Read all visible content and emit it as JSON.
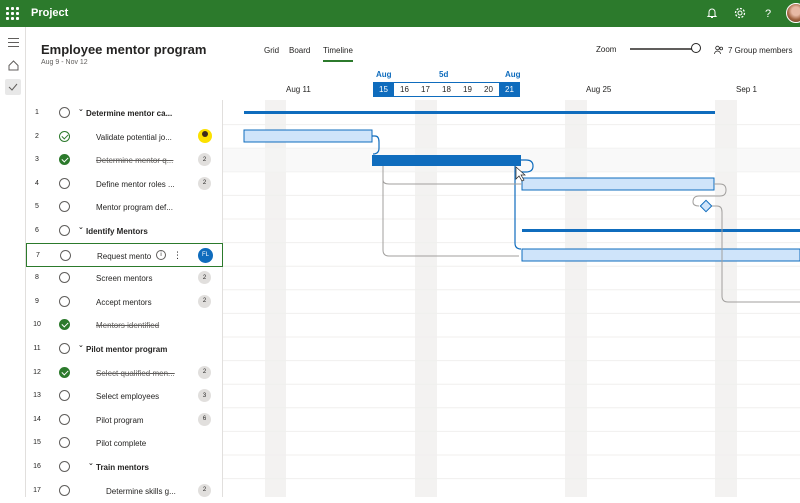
{
  "app": {
    "name": "Project"
  },
  "project": {
    "title": "Employee mentor program",
    "dates": "Aug 9 - Nov 12"
  },
  "views": [
    "Grid",
    "Board",
    "Timeline"
  ],
  "zoom": {
    "label": "Zoom",
    "level": 0.9
  },
  "group_members": "7 Group members",
  "timeline_header": {
    "months": [
      "Aug 11",
      "Aug 25",
      "Sep 1"
    ],
    "range_start_label": "Aug",
    "range_mid_label": "5d",
    "range_end_label": "Aug",
    "days": [
      "15",
      "16",
      "17",
      "18",
      "19",
      "20",
      "21"
    ]
  },
  "tasks": [
    {
      "num": "1",
      "name": "Determine mentor ca...",
      "summary": true,
      "status": "open"
    },
    {
      "num": "2",
      "name": "Validate potential jo...",
      "status": "half",
      "assignee": "person"
    },
    {
      "num": "3",
      "name": "Determine mentor q...",
      "status": "done",
      "badge": "2"
    },
    {
      "num": "4",
      "name": "Define mentor roles ...",
      "status": "open",
      "badge": "2"
    },
    {
      "num": "5",
      "name": "Mentor program def...",
      "status": "open"
    },
    {
      "num": "6",
      "name": "Identify Mentors",
      "summary": true,
      "status": "open"
    },
    {
      "num": "7",
      "name": "Request mento",
      "status": "open",
      "assignee_initials": "FL",
      "selected": true
    },
    {
      "num": "8",
      "name": "Screen mentors",
      "status": "open",
      "badge": "2"
    },
    {
      "num": "9",
      "name": "Accept mentors",
      "status": "open",
      "badge": "2"
    },
    {
      "num": "10",
      "name": "Mentors identified",
      "status": "done"
    },
    {
      "num": "11",
      "name": "Pilot mentor program",
      "summary": true,
      "status": "open"
    },
    {
      "num": "12",
      "name": "Select qualified men...",
      "status": "done",
      "badge": "2"
    },
    {
      "num": "13",
      "name": "Select employees",
      "status": "open",
      "badge": "3"
    },
    {
      "num": "14",
      "name": "Pilot program",
      "status": "open",
      "badge": "6"
    },
    {
      "num": "15",
      "name": "Pilot complete",
      "status": "open"
    },
    {
      "num": "16",
      "name": "Train mentors",
      "summary": true,
      "status": "open"
    },
    {
      "num": "17",
      "name": "Determine skills g...",
      "status": "open",
      "badge": "2"
    }
  ],
  "colors": {
    "brand": "#2c7a2c",
    "accent": "#0f6cbd",
    "bar_light": "#cfe4fa"
  }
}
